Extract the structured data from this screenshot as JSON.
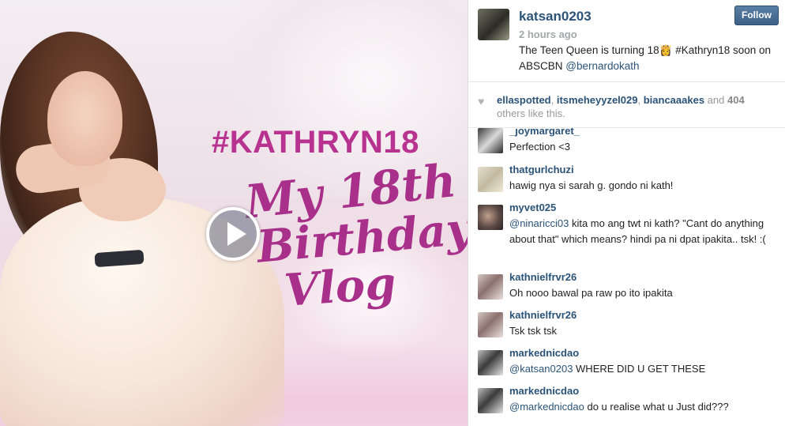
{
  "media": {
    "hashtag": "#KATHRYN18",
    "script_line_1": "My 18th",
    "script_line_2": "Birthday",
    "script_line_3": "Vlog",
    "play_icon": "play-icon"
  },
  "post": {
    "username": "katsan0203",
    "time": "2 hours ago",
    "caption_text": "The Teen Queen is turning 18",
    "caption_emoji": "👸",
    "caption_tail": " #Kathryn18 soon on ABSCBN ",
    "caption_mention": "@bernardokath",
    "follow_label": "Follow"
  },
  "likes": {
    "icon": "heart-icon",
    "liker_1": "ellaspotted",
    "sep_1": ", ",
    "liker_2": "itsmeheyyzel029",
    "sep_2": ", ",
    "liker_3": "biancaaakes",
    "and": " and ",
    "count": "404",
    "others": " others like this."
  },
  "comments": [
    {
      "user": "_joymargaret_",
      "text": "Perfection <3"
    },
    {
      "user": "thatgurlchuzi",
      "text": "hawig nya si sarah g. gondo ni kath!"
    },
    {
      "user": "myvet025",
      "mention": "@ninaricci03",
      "text": " kita mo ang twt ni kath? \"Cant do anything about that\" which means? hindi pa ni dpat ipakita.. tsk! :("
    },
    {
      "user": "kathnielfrvr26",
      "text": "Oh nooo bawal pa raw po ito ipakita"
    },
    {
      "user": "kathnielfrvr26",
      "text": "Tsk tsk tsk"
    },
    {
      "user": "markednicdao",
      "mention": "@katsan0203",
      "text": " WHERE DID U GET THESE"
    },
    {
      "user": "markednicdao",
      "mention": "@markednicdao",
      "text": " do u realise what u Just did???"
    }
  ],
  "colors": {
    "link": "#2b5378",
    "accent_pink": "#b8338f",
    "follow_button": "#3d6187"
  }
}
